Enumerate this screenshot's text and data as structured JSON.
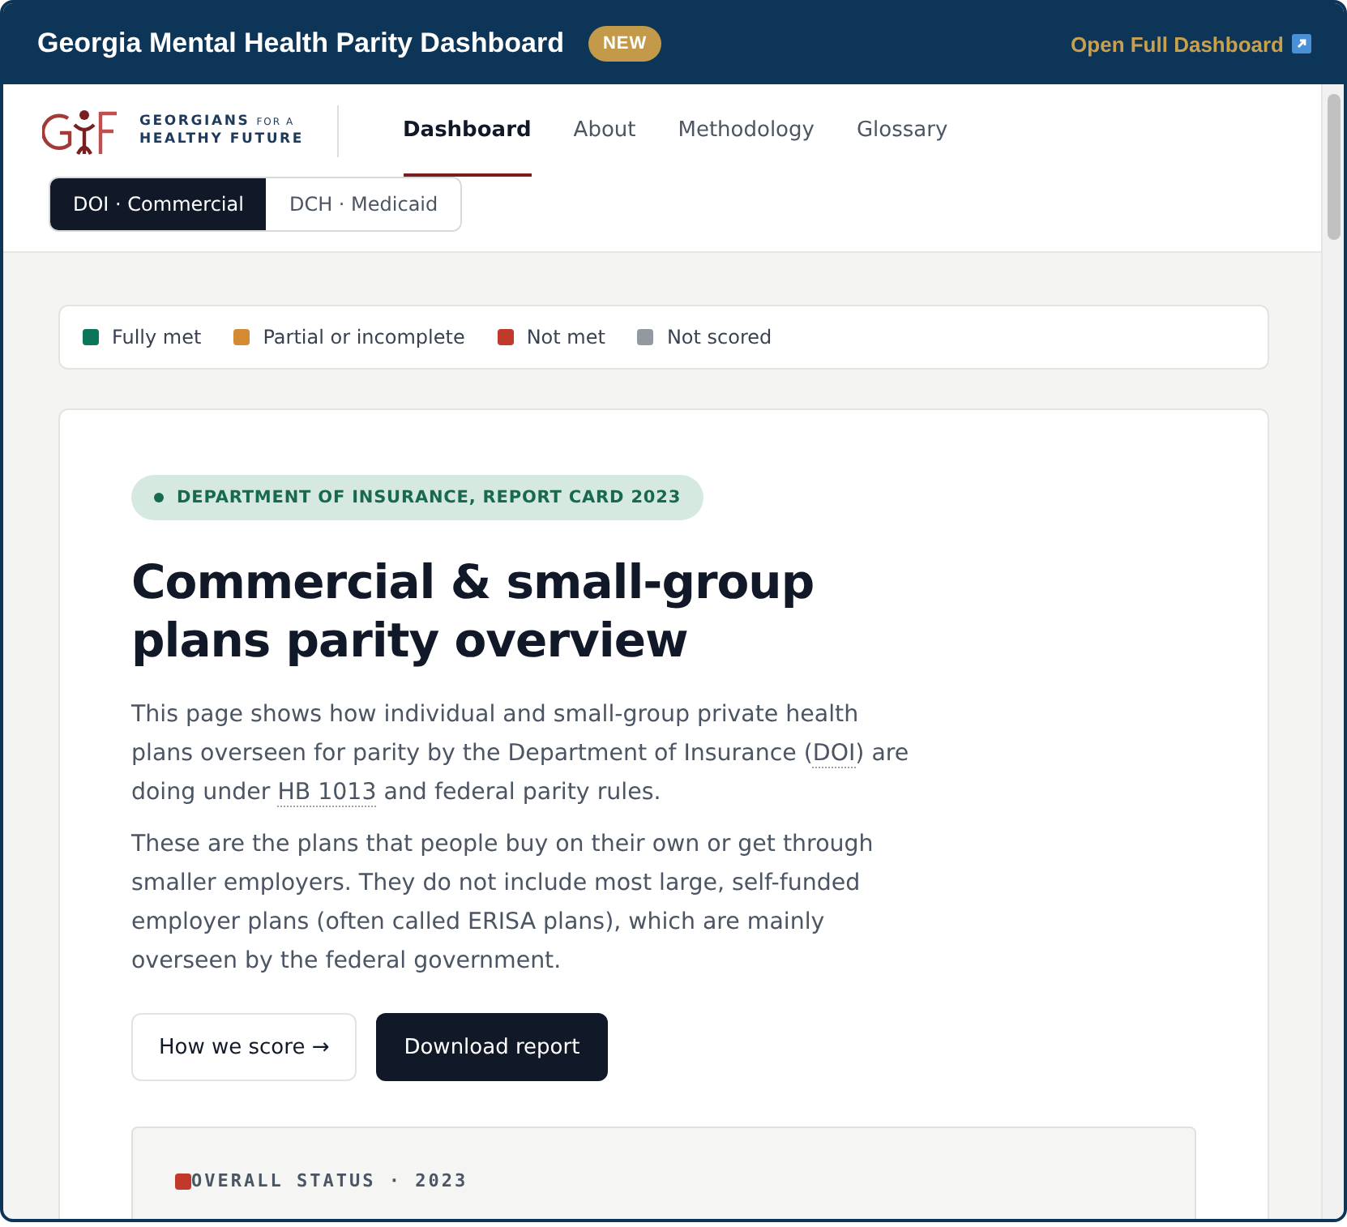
{
  "window": {
    "title": "Georgia Mental Health Parity Dashboard",
    "badge": "NEW",
    "link": "Open Full Dashboard"
  },
  "brand": {
    "line1": "GEORGIANS",
    "line1_small": "FOR A",
    "line2": "HEALTHY FUTURE"
  },
  "nav": [
    {
      "label": "Dashboard",
      "selected": true
    },
    {
      "label": "About",
      "selected": false
    },
    {
      "label": "Methodology",
      "selected": false
    },
    {
      "label": "Glossary",
      "selected": false
    }
  ],
  "segments": [
    {
      "label": "DOI · Commercial",
      "selected": true
    },
    {
      "label": "DCH · Medicaid",
      "selected": false
    }
  ],
  "legend": [
    {
      "label": "Fully met",
      "color": "#0b7559"
    },
    {
      "label": "Partial or incomplete",
      "color": "#d48a32"
    },
    {
      "label": "Not met",
      "color": "#c0392b"
    },
    {
      "label": "Not scored",
      "color": "#9399a0"
    }
  ],
  "hero": {
    "eyebrow": "DEPARTMENT OF INSURANCE, REPORT CARD 2023",
    "title": "Commercial & small-group plans parity overview",
    "paragraphs": [
      [
        {
          "kind": "text",
          "text": "This page shows how individual and small-group private health plans overseen for parity by the Department of Insurance ("
        },
        {
          "kind": "term",
          "text": "DOI"
        },
        {
          "kind": "text",
          "text": ") are doing under "
        },
        {
          "kind": "term",
          "text": "HB 1013"
        },
        {
          "kind": "text",
          "text": " and federal parity rules."
        }
      ],
      [
        {
          "kind": "text",
          "text": "These are the plans that people buy on their own or get through smaller employers. They do not include most large, self-funded employer plans (often called ERISA plans), which are mainly overseen by the federal government."
        }
      ]
    ],
    "buttons": [
      {
        "label": "How we score →",
        "kind": "secondary"
      },
      {
        "label": "Download report",
        "kind": "primary"
      }
    ]
  },
  "status": {
    "label": "OVERALL STATUS · 2023",
    "color": "#c0392b"
  }
}
